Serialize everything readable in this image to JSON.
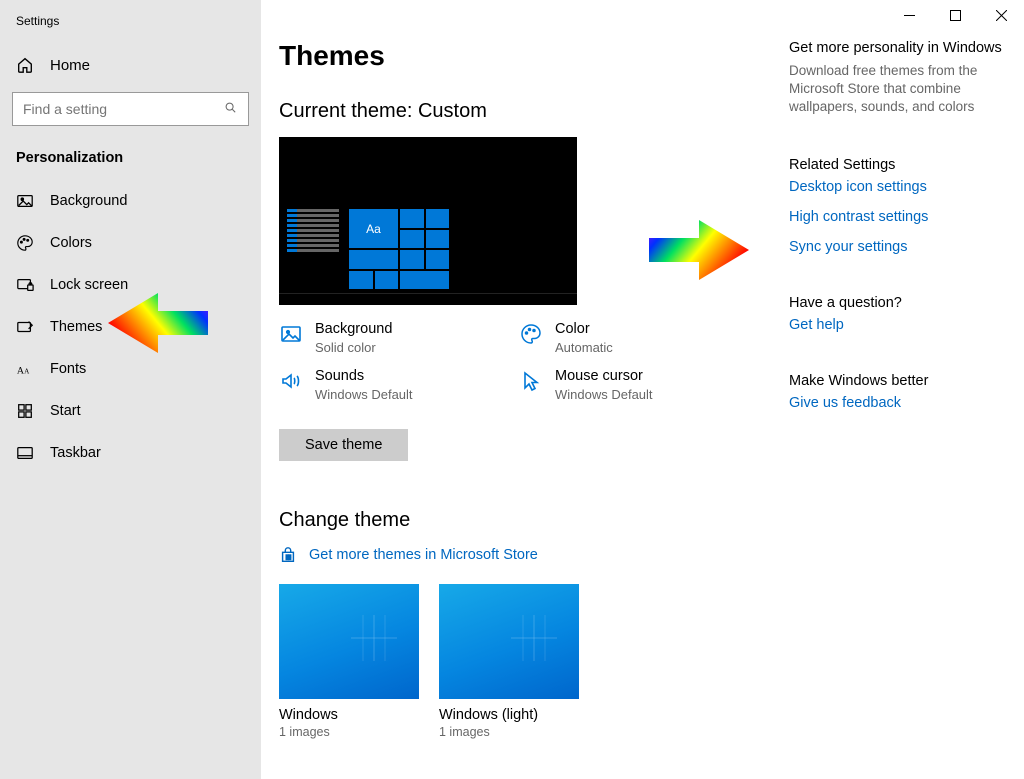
{
  "app_title": "Settings",
  "home_label": "Home",
  "search_placeholder": "Find a setting",
  "section_header": "Personalization",
  "nav": [
    {
      "key": "background",
      "label": "Background"
    },
    {
      "key": "colors",
      "label": "Colors"
    },
    {
      "key": "lock-screen",
      "label": "Lock screen"
    },
    {
      "key": "themes",
      "label": "Themes"
    },
    {
      "key": "fonts",
      "label": "Fonts"
    },
    {
      "key": "start",
      "label": "Start"
    },
    {
      "key": "taskbar",
      "label": "Taskbar"
    }
  ],
  "page_heading": "Themes",
  "current_theme_label": "Current theme: Custom",
  "preview_sample": "Aa",
  "props": {
    "background": {
      "title": "Background",
      "sub": "Solid color"
    },
    "color": {
      "title": "Color",
      "sub": "Automatic"
    },
    "sounds": {
      "title": "Sounds",
      "sub": "Windows Default"
    },
    "mouse": {
      "title": "Mouse cursor",
      "sub": "Windows Default"
    }
  },
  "save_button": "Save theme",
  "change_theme_heading": "Change theme",
  "store_link": "Get more themes in Microsoft Store",
  "themes": [
    {
      "title": "Windows",
      "sub": "1 images"
    },
    {
      "title": "Windows (light)",
      "sub": "1 images"
    }
  ],
  "rail": {
    "personality": {
      "head": "Get more personality in Windows",
      "text": "Download free themes from the Microsoft Store that combine wallpapers, sounds, and colors"
    },
    "related_head": "Related Settings",
    "related_links": [
      "Desktop icon settings",
      "High contrast settings",
      "Sync your settings"
    ],
    "question_head": "Have a question?",
    "question_link": "Get help",
    "better_head": "Make Windows better",
    "better_link": "Give us feedback"
  }
}
